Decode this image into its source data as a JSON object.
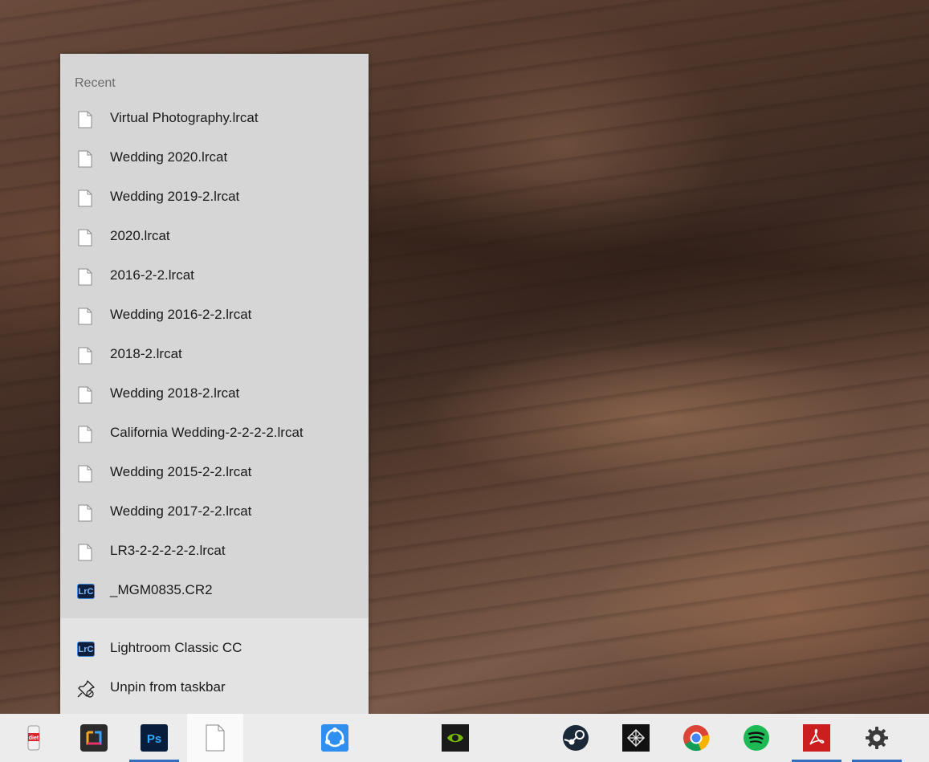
{
  "jumplist": {
    "recent_header": "Recent",
    "recent_items": [
      {
        "label": "Virtual Photography.lrcat",
        "icon": "document-icon"
      },
      {
        "label": "Wedding 2020.lrcat",
        "icon": "document-icon"
      },
      {
        "label": "Wedding 2019-2.lrcat",
        "icon": "document-icon"
      },
      {
        "label": "2020.lrcat",
        "icon": "document-icon"
      },
      {
        "label": "2016-2-2.lrcat",
        "icon": "document-icon"
      },
      {
        "label": "Wedding 2016-2-2.lrcat",
        "icon": "document-icon"
      },
      {
        "label": "2018-2.lrcat",
        "icon": "document-icon"
      },
      {
        "label": "Wedding 2018-2.lrcat",
        "icon": "document-icon"
      },
      {
        "label": "California Wedding-2-2-2-2.lrcat",
        "icon": "document-icon"
      },
      {
        "label": "Wedding 2015-2-2.lrcat",
        "icon": "document-icon"
      },
      {
        "label": "Wedding 2017-2-2.lrcat",
        "icon": "document-icon"
      },
      {
        "label": "LR3-2-2-2-2-2.lrcat",
        "icon": "document-icon"
      },
      {
        "label": "_MGM0835.CR2",
        "icon": "lightroom-classic-icon"
      }
    ],
    "tasks": [
      {
        "label": "Lightroom Classic CC",
        "icon": "lightroom-classic-icon"
      },
      {
        "label": "Unpin from taskbar",
        "icon": "unpin-icon"
      }
    ],
    "lrc_badge_text": "LrC"
  },
  "taskbar": {
    "apps": [
      {
        "name": "diet-soda-app-icon",
        "running": false
      },
      {
        "name": "creative-cloud-app-icon",
        "running": false
      },
      {
        "name": "photoshop-icon",
        "running": true
      },
      {
        "name": "lightroom-document-icon",
        "running": false,
        "active": true
      },
      {
        "name": "sharing-app-icon",
        "running": false
      },
      {
        "name": "nvidia-icon",
        "running": false
      },
      {
        "name": "steam-icon",
        "running": false
      },
      {
        "name": "network-tool-icon",
        "running": false
      },
      {
        "name": "chrome-icon",
        "running": false
      },
      {
        "name": "spotify-icon",
        "running": false
      },
      {
        "name": "acrobat-icon",
        "running": true
      },
      {
        "name": "settings-gear-icon",
        "running": true
      }
    ],
    "ps_text": "Ps",
    "soda_text": "diet"
  },
  "colors": {
    "accent_underline": "#2f6fbd",
    "jumplist_recent_bg": "#d6d6d6",
    "jumplist_tasks_bg": "#e3e3e3",
    "taskbar_bg": "#ececec"
  }
}
